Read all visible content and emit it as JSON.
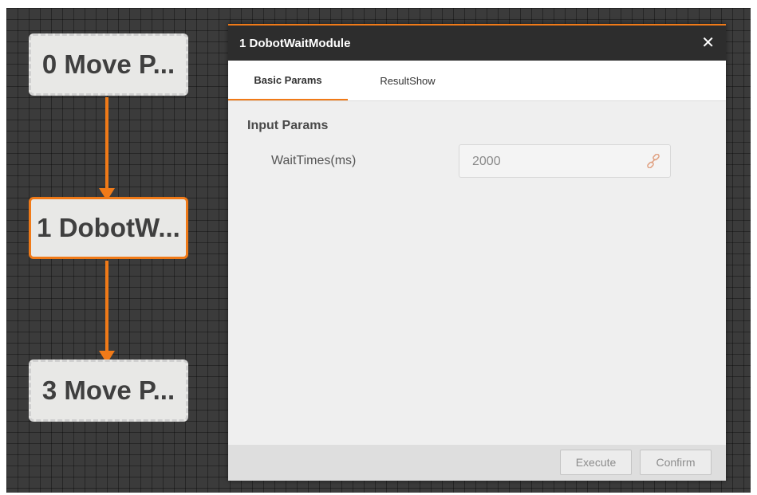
{
  "flow": {
    "nodes": [
      {
        "label": "0 Move P...",
        "state": "idle"
      },
      {
        "label": "1 DobotW...",
        "state": "selected"
      },
      {
        "label": "3 Move P...",
        "state": "idle"
      }
    ]
  },
  "dialog": {
    "title": "1 DobotWaitModule",
    "close_glyph": "✕",
    "tabs": [
      {
        "label": "Basic Params",
        "active": true
      },
      {
        "label": "ResultShow",
        "active": false
      }
    ],
    "section_title": "Input Params",
    "params": [
      {
        "label": "WaitTimes(ms)",
        "value": "2000",
        "icon": "link-icon"
      }
    ],
    "buttons": {
      "execute": "Execute",
      "confirm": "Confirm"
    }
  },
  "colors": {
    "accent": "#f07a18",
    "canvas_bg": "#3b3b3b",
    "titlebar_bg": "#2d2d2d",
    "node_bg": "#e8e8e6"
  }
}
